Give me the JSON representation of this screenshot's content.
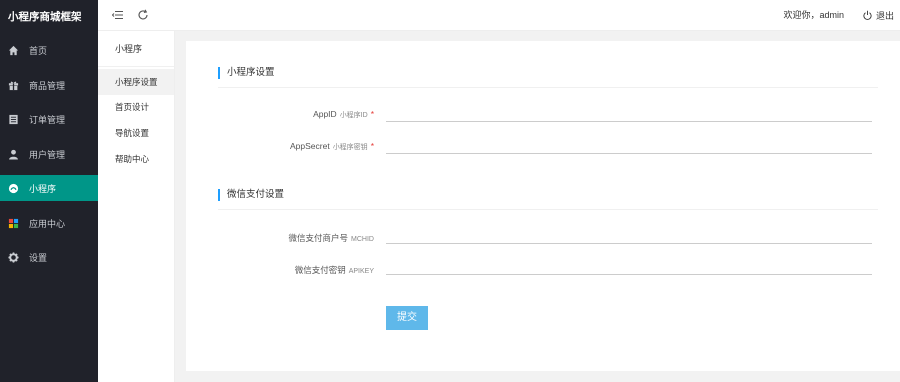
{
  "sidebar": {
    "brand": "小程序商城框架",
    "items": [
      {
        "label": "首页",
        "icon": "home-icon"
      },
      {
        "label": "商品管理",
        "icon": "gift-icon"
      },
      {
        "label": "订单管理",
        "icon": "order-list-icon"
      },
      {
        "label": "用户管理",
        "icon": "user-icon"
      },
      {
        "label": "小程序",
        "icon": "miniprogram-icon",
        "active": true
      },
      {
        "label": "应用中心",
        "icon": "apps-icon"
      },
      {
        "label": "设置",
        "icon": "gear-icon"
      }
    ],
    "active_color": "#009688"
  },
  "header": {
    "welcome": "欢迎你，admin",
    "logout": "退出"
  },
  "subnav": {
    "title": "小程序",
    "items": [
      {
        "label": "小程序设置",
        "active": true
      },
      {
        "label": "首页设计"
      },
      {
        "label": "导航设置"
      },
      {
        "label": "帮助中心"
      }
    ]
  },
  "form": {
    "section1_title": "小程序设置",
    "appid_label": "AppID",
    "appid_hint": "小程序ID",
    "appid_required": "*",
    "appid_value": "",
    "appsecret_label": "AppSecret",
    "appsecret_hint": "小程序密钥",
    "appsecret_required": "*",
    "appsecret_value": "",
    "section2_title": "微信支付设置",
    "mchid_label": "微信支付商户号",
    "mchid_hint": "MCHID",
    "mchid_value": "",
    "apikey_label": "微信支付密钥",
    "apikey_hint": "APIKEY",
    "apikey_value": "",
    "submit_label": "提交",
    "accent_color": "#1e9fff",
    "button_color": "#5fb8ea"
  }
}
